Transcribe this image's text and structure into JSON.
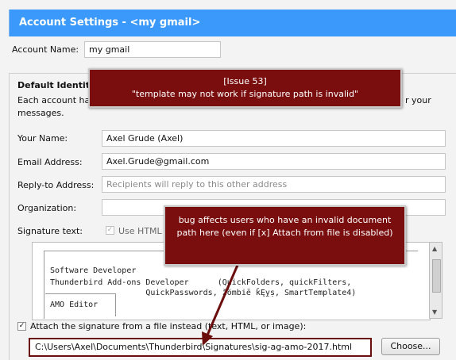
{
  "header": {
    "title": "Account Settings - <my gmail>"
  },
  "account": {
    "label": "Account Name:",
    "value": "my gmail"
  },
  "identity": {
    "heading": "Default Identity",
    "desc_line1": "Each account has",
    "desc_line1_tail": "r your",
    "desc_line2": "messages."
  },
  "fields": {
    "name_label": "Your Name:",
    "name_value": "Axel Grude (Axel)",
    "email_label": "Email Address:",
    "email_value": "Axel.Grude@gmail.com",
    "replyto_label": "Reply-to Address:",
    "replyto_placeholder": "Recipients will reply to this other address",
    "org_label": "Organization:",
    "org_value": ""
  },
  "signature": {
    "label": "Signature text:",
    "use_html": "Use HTML",
    "lines": [
      "Software Developer",
      "Thunderbird Add-ons Developer      (QuickFolders, quickFilters,",
      "                    QuickPasswords, žömbiē ǩĘỵṣ, SmartTemplate4)",
      "AMO Editor"
    ]
  },
  "attach": {
    "label": "Attach the signature from a file instead (text, HTML, or image):",
    "checked": true,
    "path": "C:\\Users\\Axel\\Documents\\Thunderbird\\Signatures\\sig-ag-amo-2017.html",
    "choose_label": "Choose..."
  },
  "callouts": {
    "issue_line1": "[Issue 53]",
    "issue_line2": "\"template may not work if signature path is invalid\"",
    "bug_text": "bug affects users who have an invalid document path here (even if [x] Attach from file is disabled)"
  },
  "colors": {
    "header": "#3b99fc",
    "callout": "#7a0e0e"
  }
}
